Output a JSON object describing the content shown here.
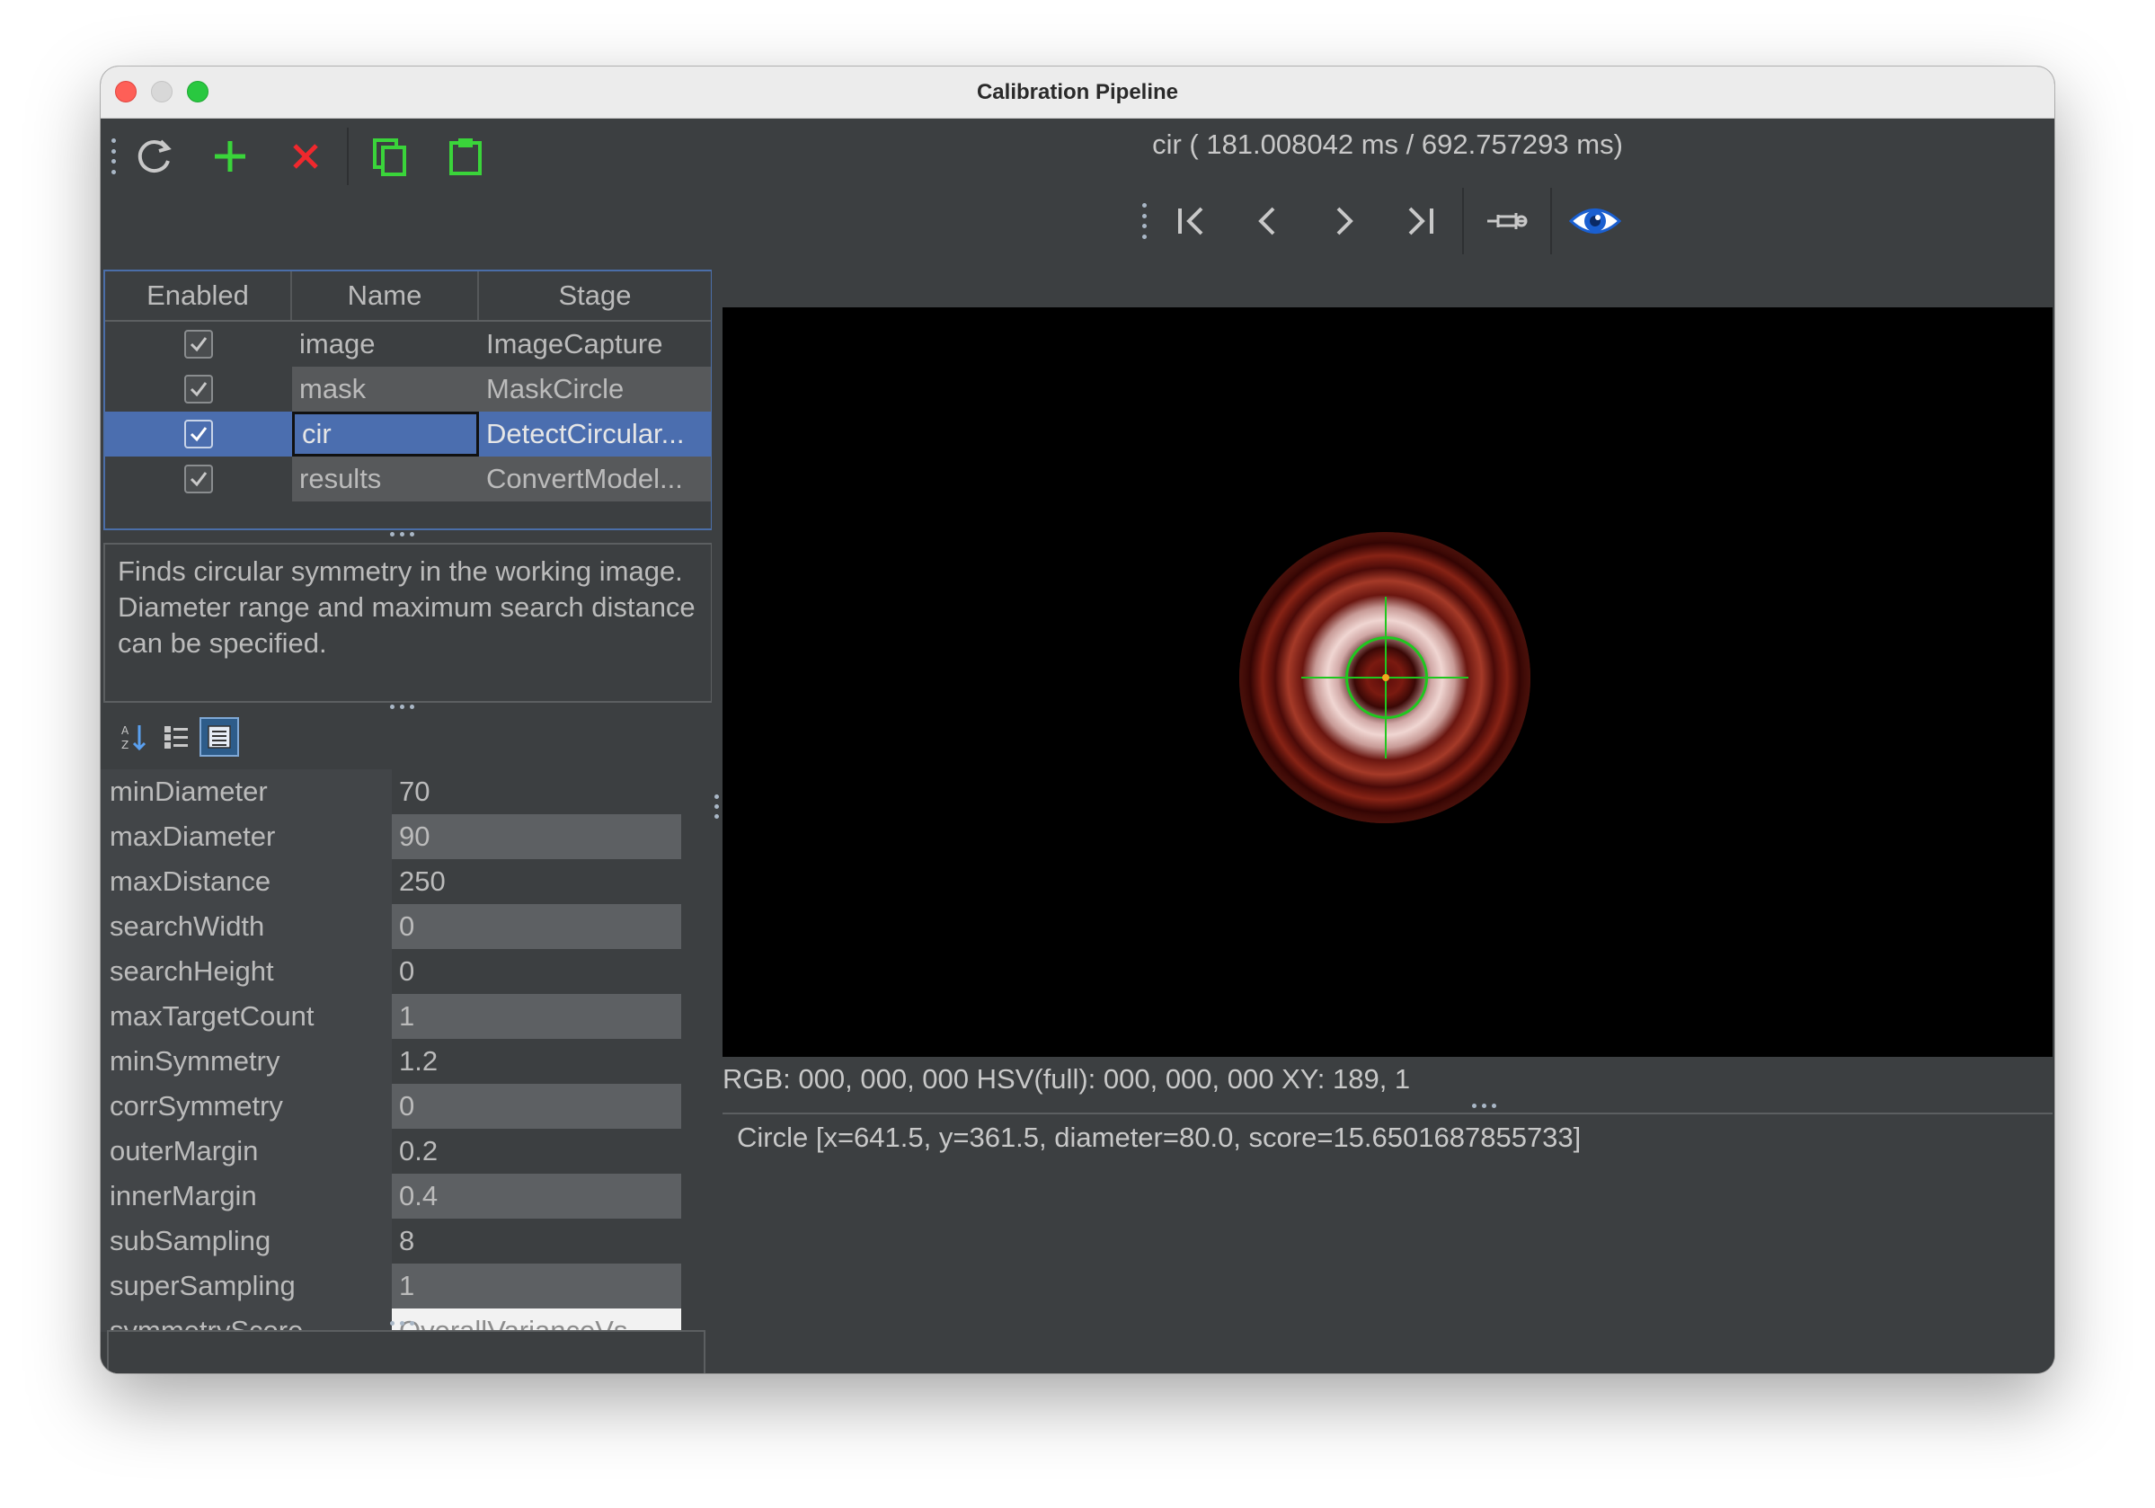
{
  "window": {
    "title": "Calibration Pipeline"
  },
  "toolbar": {
    "refresh": "refresh-icon",
    "add": "add-icon",
    "remove": "remove-icon",
    "copy": "copy-icon",
    "paste": "paste-icon"
  },
  "pipeline_table": {
    "headers": [
      "Enabled",
      "Name",
      "Stage"
    ],
    "rows": [
      {
        "enabled": true,
        "name": "image",
        "stage": "ImageCapture"
      },
      {
        "enabled": true,
        "name": "mask",
        "stage": "MaskCircle"
      },
      {
        "enabled": true,
        "name": "cir",
        "stage": "DetectCircular...",
        "selected": true
      },
      {
        "enabled": true,
        "name": "results",
        "stage": "ConvertModel..."
      }
    ]
  },
  "description": "Finds circular symmetry in the working image. Diameter range and maximum search distance can be specified.",
  "properties": [
    {
      "name": "minDiameter",
      "value": "70"
    },
    {
      "name": "maxDiameter",
      "value": "90"
    },
    {
      "name": "maxDistance",
      "value": "250"
    },
    {
      "name": "searchWidth",
      "value": "0"
    },
    {
      "name": "searchHeight",
      "value": "0"
    },
    {
      "name": "maxTargetCount",
      "value": "1"
    },
    {
      "name": "minSymmetry",
      "value": "1.2"
    },
    {
      "name": "corrSymmetry",
      "value": "0"
    },
    {
      "name": "outerMargin",
      "value": "0.2"
    },
    {
      "name": "innerMargin",
      "value": "0.4"
    },
    {
      "name": "subSampling",
      "value": "8"
    },
    {
      "name": "superSampling",
      "value": "1"
    },
    {
      "name": "symmetryScore",
      "value": "OverallVarianceVs..."
    }
  ],
  "viewer": {
    "title": "cir ( 181.008042 ms / 692.757293 ms)",
    "status": "RGB: 000, 000, 000 HSV(full): 000, 000, 000 XY: 189, 1",
    "output": "Circle [x=641.5, y=361.5, diameter=80.0, score=15.6501687855733]"
  },
  "colors": {
    "selection": "#4b6eaf",
    "panel": "#3c3f41",
    "overlay_green": "#1fc81f"
  }
}
